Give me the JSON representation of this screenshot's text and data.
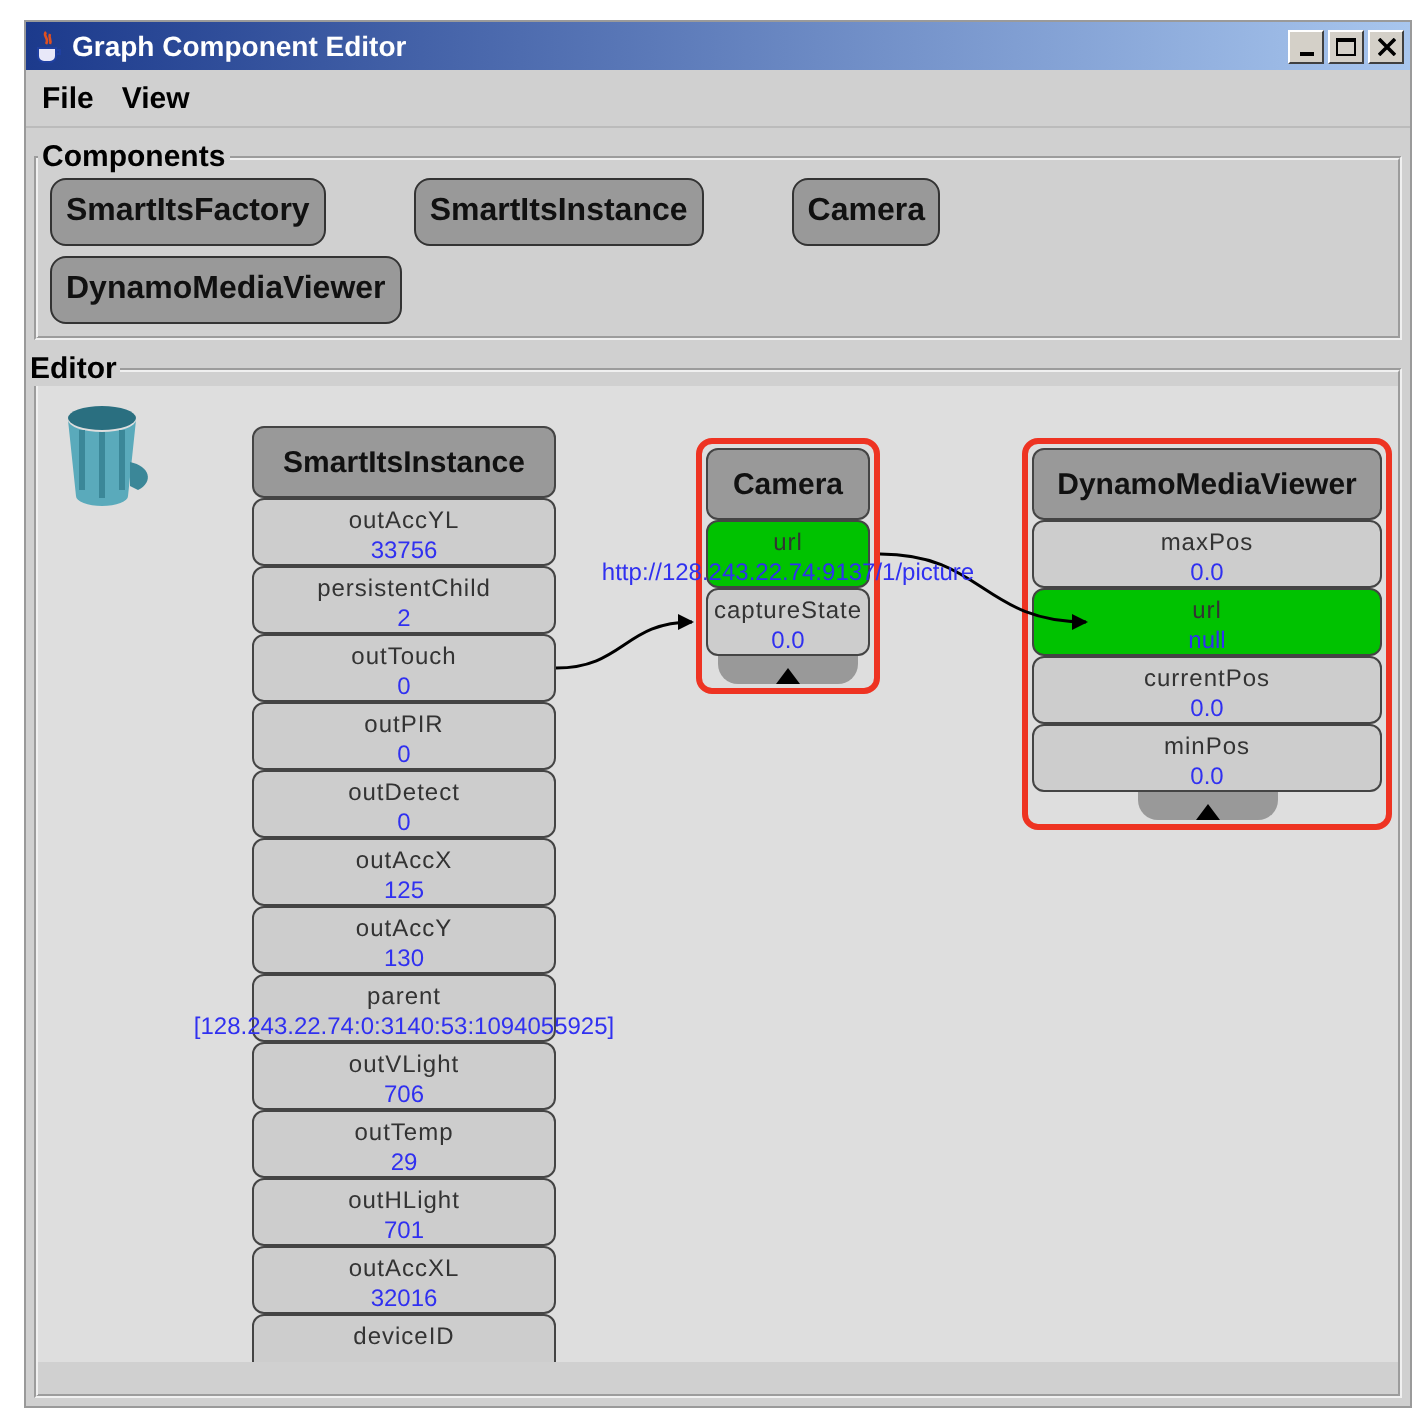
{
  "window": {
    "title": "Graph Component Editor"
  },
  "menu": [
    {
      "label": "File"
    },
    {
      "label": "View"
    }
  ],
  "components": {
    "title": "Components",
    "items": [
      "SmartItsFactory",
      "SmartItsInstance",
      "Camera",
      "DynamoMediaViewer"
    ]
  },
  "editor": {
    "title": "Editor",
    "nodes": [
      {
        "title": "SmartItsInstance",
        "selected": false,
        "expander": false,
        "properties": [
          {
            "name": "outAccYL",
            "value": "33756",
            "highlighted": false
          },
          {
            "name": "persistentChild",
            "value": "2",
            "highlighted": false
          },
          {
            "name": "outTouch",
            "value": "0",
            "highlighted": false,
            "outgoing": true
          },
          {
            "name": "outPIR",
            "value": "0",
            "highlighted": false
          },
          {
            "name": "outDetect",
            "value": "0",
            "highlighted": false
          },
          {
            "name": "outAccX",
            "value": "125",
            "highlighted": false
          },
          {
            "name": "outAccY",
            "value": "130",
            "highlighted": false
          },
          {
            "name": "parent",
            "value": "[128.243.22.74:0:3140:53:1094055925]",
            "highlighted": false
          },
          {
            "name": "outVLight",
            "value": "706",
            "highlighted": false
          },
          {
            "name": "outTemp",
            "value": "29",
            "highlighted": false
          },
          {
            "name": "outHLight",
            "value": "701",
            "highlighted": false
          },
          {
            "name": "outAccXL",
            "value": "32016",
            "highlighted": false
          },
          {
            "name": "deviceID",
            "highlighted": false
          }
        ]
      },
      {
        "title": "Camera",
        "selected": true,
        "expander": true,
        "properties": [
          {
            "name": "url",
            "value": "http://128.243.22.74:9137/1/picture",
            "highlighted": true,
            "outgoing": true
          },
          {
            "name": "captureState",
            "value": "0.0",
            "highlighted": false,
            "incoming": true
          }
        ]
      },
      {
        "title": "DynamoMediaViewer",
        "selected": true,
        "expander": true,
        "properties": [
          {
            "name": "maxPos",
            "value": "0.0",
            "highlighted": false
          },
          {
            "name": "url",
            "value": "null",
            "highlighted": true,
            "incoming": true
          },
          {
            "name": "currentPos",
            "value": "0.0",
            "highlighted": false
          },
          {
            "name": "minPos",
            "value": "0.0",
            "highlighted": false
          }
        ]
      }
    ]
  }
}
